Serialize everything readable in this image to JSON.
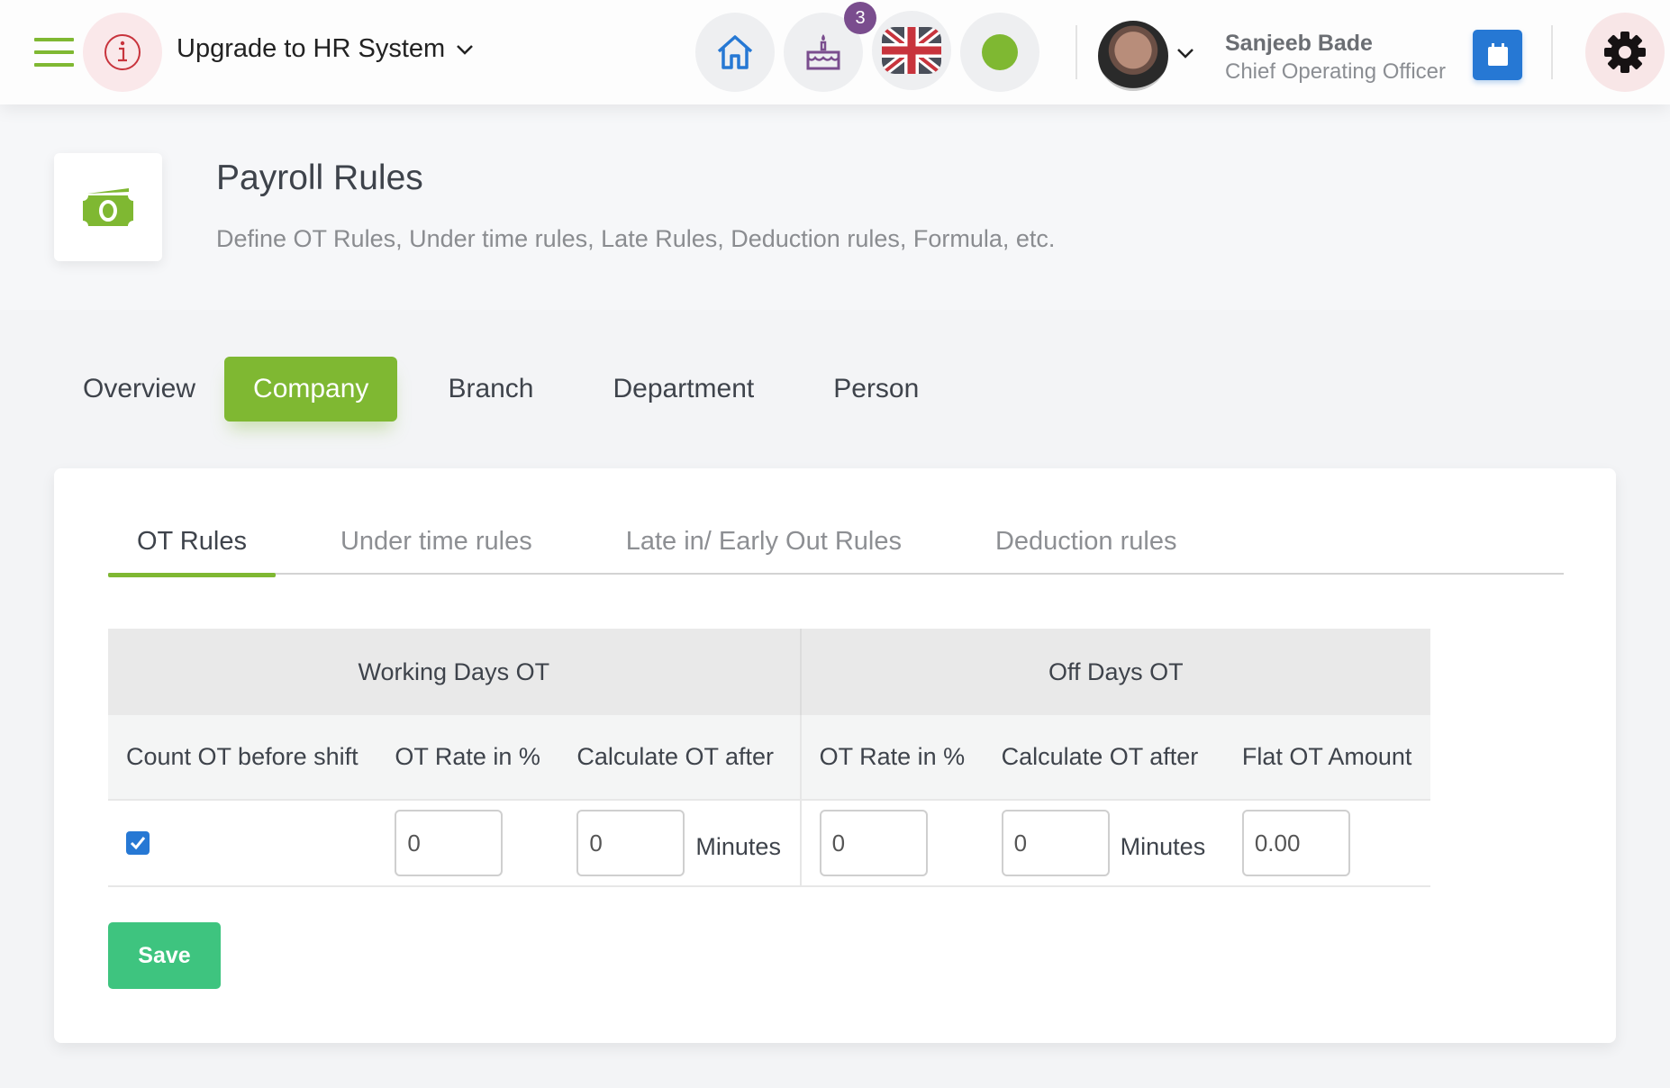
{
  "header": {
    "upgrade_label": "Upgrade to HR System",
    "notification_count": "3",
    "user": {
      "name": "Sanjeeb Bade",
      "role": "Chief Operating Officer"
    },
    "icons": [
      "menu-icon",
      "info-icon",
      "home-icon",
      "birthday-cake-icon",
      "uk-flag-icon",
      "online-status-icon",
      "avatar",
      "calendar-icon",
      "gear-icon"
    ],
    "colors": {
      "accent_green": "#7fb832",
      "primary_blue": "#2678d4",
      "badge_purple": "#7a4d8e",
      "save_green": "#3ec47f"
    }
  },
  "page": {
    "title": "Payroll Rules",
    "subtitle": "Define OT Rules, Under time rules, Late Rules, Deduction rules, Formula, etc."
  },
  "main_tabs": [
    {
      "label": "Overview",
      "active": false
    },
    {
      "label": "Company",
      "active": true
    },
    {
      "label": "Branch",
      "active": false
    },
    {
      "label": "Department",
      "active": false
    },
    {
      "label": "Person",
      "active": false
    }
  ],
  "sub_tabs": [
    {
      "label": "OT Rules",
      "active": true
    },
    {
      "label": "Under time rules",
      "active": false
    },
    {
      "label": "Late in/ Early Out Rules",
      "active": false
    },
    {
      "label": "Deduction rules",
      "active": false
    }
  ],
  "table": {
    "groups": [
      "Working Days OT",
      "Off Days OT"
    ],
    "columns": [
      "Count OT before shift",
      "OT Rate in %",
      "Calculate OT after",
      "OT Rate in %",
      "Calculate OT after",
      "Flat OT Amount"
    ],
    "row": {
      "count_before_shift": true,
      "working_rate": "0",
      "working_after": "0",
      "working_after_unit": "Minutes",
      "off_rate": "0",
      "off_after": "0",
      "off_after_unit": "Minutes",
      "flat_amount": "0.00"
    }
  },
  "actions": {
    "save_label": "Save"
  }
}
